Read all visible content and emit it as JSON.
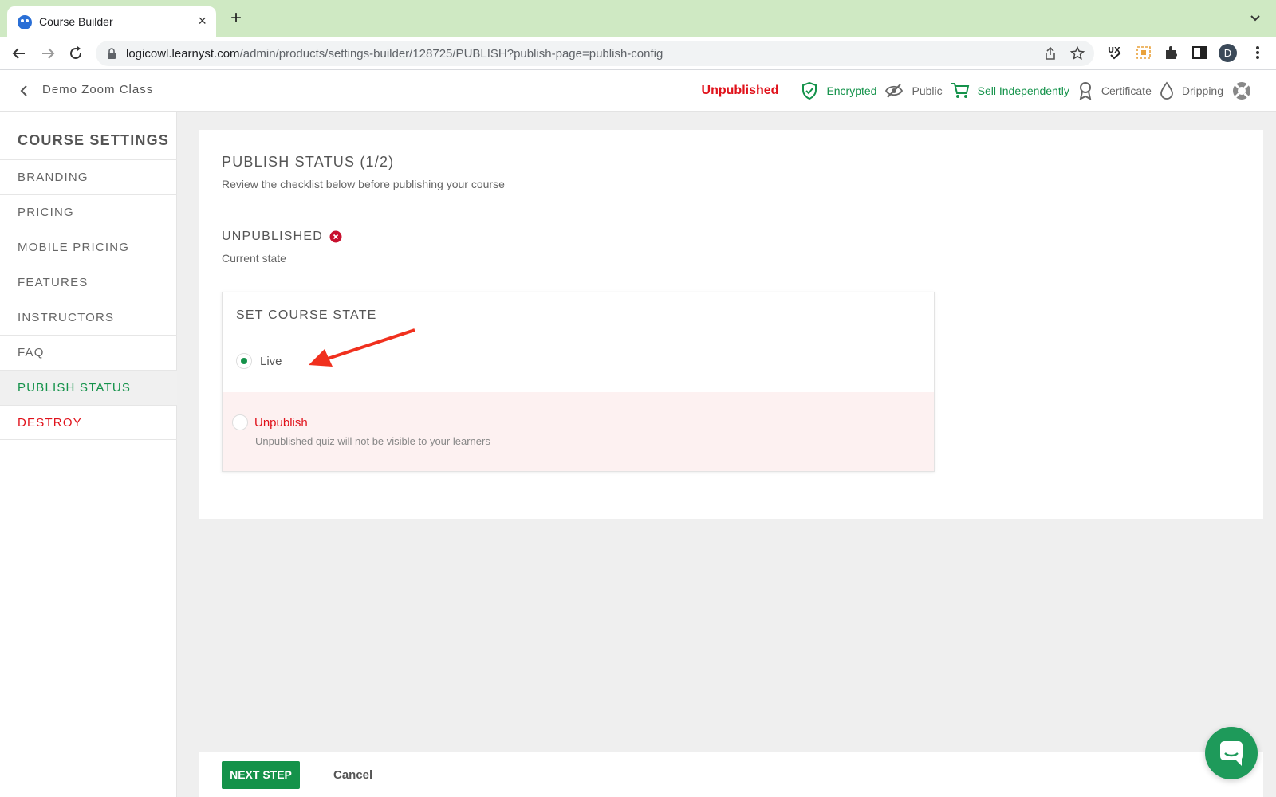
{
  "browser": {
    "tab_title": "Course Builder",
    "tab_close": "×",
    "new_tab": "+",
    "url_host": "logicowl.learnyst.com",
    "url_path": "/admin/products/settings-builder/128725/PUBLISH?publish-page=publish-config",
    "profile_initial": "D"
  },
  "header": {
    "course_name": "Demo Zoom Class",
    "status": "Unpublished",
    "badges": [
      {
        "label": "Encrypted",
        "icon": "shield-check-icon",
        "color": "#14924a"
      },
      {
        "label": "Public",
        "icon": "eye-slash-icon",
        "color": "#666666"
      },
      {
        "label": "Sell Independently",
        "icon": "cart-icon",
        "color": "#14924a"
      },
      {
        "label": "Certificate",
        "icon": "ribbon-icon",
        "color": "#666666"
      },
      {
        "label": "Dripping",
        "icon": "drop-icon",
        "color": "#666666"
      }
    ]
  },
  "sidebar": {
    "heading": "COURSE SETTINGS",
    "items": [
      {
        "label": "BRANDING"
      },
      {
        "label": "PRICING"
      },
      {
        "label": "MOBILE PRICING"
      },
      {
        "label": "FEATURES"
      },
      {
        "label": "INSTRUCTORS"
      },
      {
        "label": "FAQ"
      },
      {
        "label": "PUBLISH STATUS"
      },
      {
        "label": "DESTROY"
      }
    ]
  },
  "main": {
    "title": "PUBLISH STATUS (1/2)",
    "subtitle": "Review the checklist below before publishing your course",
    "state_title": "UNPUBLISHED",
    "state_sub": "Current state",
    "card": {
      "title": "SET COURSE STATE",
      "live_label": "Live",
      "unpublish_label": "Unpublish",
      "unpublish_help": "Unpublished quiz will not be visible to your learners"
    }
  },
  "footer": {
    "next_label": "NEXT STEP",
    "cancel_label": "Cancel"
  },
  "colors": {
    "accent_green": "#14924a",
    "danger_red": "#e0121b",
    "tabbar": "#cfe9c3"
  }
}
